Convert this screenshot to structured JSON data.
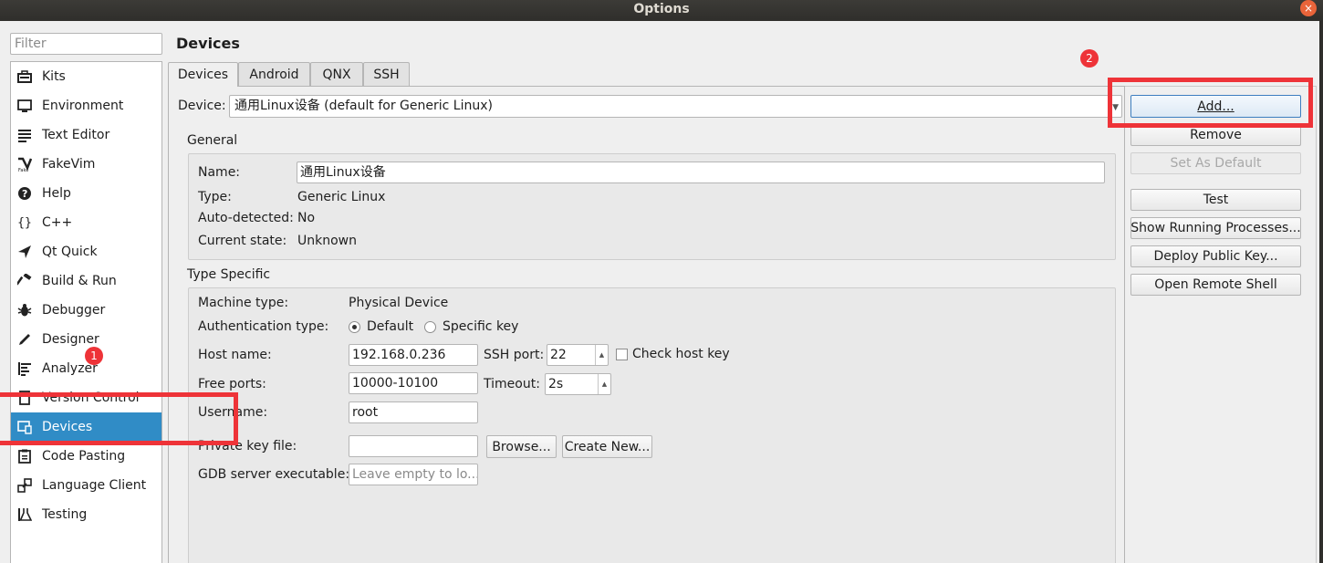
{
  "window": {
    "title": "Options",
    "close_glyph": "×"
  },
  "sidebar": {
    "filter_placeholder": "Filter",
    "items": [
      {
        "label": "Kits",
        "icon": "kits-icon"
      },
      {
        "label": "Environment",
        "icon": "monitor-icon"
      },
      {
        "label": "Text Editor",
        "icon": "text-editor-icon"
      },
      {
        "label": "FakeVim",
        "icon": "fakevim-icon"
      },
      {
        "label": "Help",
        "icon": "help-icon"
      },
      {
        "label": "C++",
        "icon": "braces-icon"
      },
      {
        "label": "Qt Quick",
        "icon": "qt-quick-icon"
      },
      {
        "label": "Build & Run",
        "icon": "hammer-icon"
      },
      {
        "label": "Debugger",
        "icon": "bug-icon"
      },
      {
        "label": "Designer",
        "icon": "pen-icon"
      },
      {
        "label": "Analyzer",
        "icon": "analyzer-icon"
      },
      {
        "label": "Version Control",
        "icon": "version-control-icon"
      },
      {
        "label": "Devices",
        "icon": "device-icon",
        "selected": true
      },
      {
        "label": "Code Pasting",
        "icon": "clipboard-icon"
      },
      {
        "label": "Language Client",
        "icon": "plug-icon"
      },
      {
        "label": "Testing",
        "icon": "flask-icon"
      }
    ]
  },
  "page": {
    "title": "Devices"
  },
  "tabs": [
    "Devices",
    "Android",
    "QNX",
    "SSH"
  ],
  "device": {
    "label": "Device:",
    "value": "通用Linux设备 (default for Generic Linux)"
  },
  "general": {
    "title": "General",
    "name_label": "Name:",
    "name_value": "通用Linux设备",
    "type_label": "Type:",
    "type_value": "Generic Linux",
    "autodetected_label": "Auto-detected:",
    "autodetected_value": "No",
    "state_label": "Current state:",
    "state_value": "Unknown"
  },
  "type_specific": {
    "title": "Type Specific",
    "machine_type_label": "Machine type:",
    "machine_type_value": "Physical Device",
    "auth_label": "Authentication type:",
    "auth_default": "Default",
    "auth_specific": "Specific key",
    "auth_selected": "Default",
    "host_label": "Host name:",
    "host_value": "192.168.0.236",
    "ssh_port_label": "SSH port:",
    "ssh_port_value": "22",
    "check_host_key_label": "Check host key",
    "check_host_key_checked": false,
    "free_ports_label": "Free ports:",
    "free_ports_value": "10000-10100",
    "timeout_label": "Timeout:",
    "timeout_value": "2s",
    "username_label": "Username:",
    "username_value": "root",
    "private_key_label": "Private key file:",
    "private_key_value": "",
    "browse_label": "Browse...",
    "create_new_label": "Create New...",
    "gdb_label": "GDB server executable:",
    "gdb_placeholder": "Leave empty to lo..."
  },
  "actions": {
    "add": "Add...",
    "remove": "Remove",
    "set_default": "Set As Default",
    "test": "Test",
    "show_processes": "Show Running Processes...",
    "deploy_key": "Deploy Public Key...",
    "open_shell": "Open Remote Shell"
  },
  "annotations": {
    "badge_1": "1",
    "badge_2": "2",
    "highlight_color": "#ee3338"
  },
  "colors": {
    "selection": "#308cc6",
    "titlebar": "#2f2e2b",
    "close_button": "#e9643a"
  }
}
